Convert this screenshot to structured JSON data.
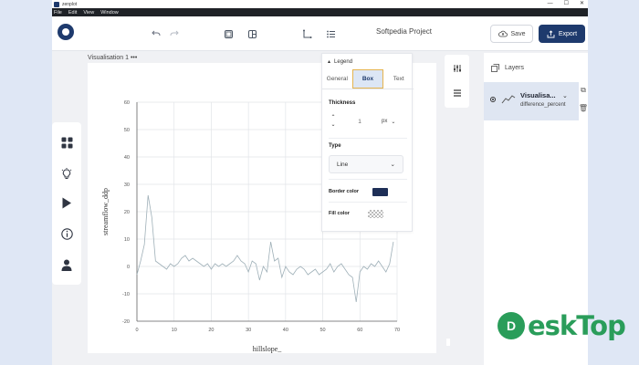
{
  "window": {
    "app_title": "zenplot",
    "controls": [
      "—",
      "☐",
      "✕"
    ]
  },
  "menu": [
    "File",
    "Edit",
    "View",
    "Window"
  ],
  "toolbar": {
    "project_title": "Softpedia Project",
    "save_label": "Save",
    "export_label": "Export"
  },
  "visualisation": {
    "title": "Visualisation 1"
  },
  "legend_panel": {
    "header": "Legend",
    "tabs": [
      "General",
      "Box",
      "Text"
    ],
    "active_tab": "Box",
    "thickness_label": "Thickness",
    "thickness_value": "1",
    "thickness_unit": "px",
    "type_label": "Type",
    "type_value": "Line",
    "border_color_label": "Border color",
    "border_color": "#1e2f57",
    "fill_color_label": "Fill color"
  },
  "layers_panel": {
    "title": "Layers",
    "items": [
      {
        "name": "Visualisa...",
        "subtitle": "difference_percent"
      }
    ]
  },
  "watermark": {
    "letter": "D",
    "text": "eskTop"
  },
  "colors": {
    "brand": "#1e3a6d",
    "series": "#9fb0b8",
    "watermark": "#2a9d5a"
  },
  "chart_data": {
    "type": "line",
    "xlabel": "hillslope_",
    "ylabel": "streamflow_ddp",
    "xlim": [
      0,
      70
    ],
    "ylim": [
      -20,
      60
    ],
    "xticks": [
      0,
      10,
      20,
      30,
      40,
      50,
      60,
      70
    ],
    "yticks": [
      -20,
      -10,
      0,
      10,
      20,
      30,
      40,
      50,
      60
    ],
    "grid": true,
    "series": [
      {
        "values": [
          [
            0,
            -3
          ],
          [
            1,
            2
          ],
          [
            2,
            8
          ],
          [
            3,
            26
          ],
          [
            4,
            18
          ],
          [
            5,
            2
          ],
          [
            6,
            1
          ],
          [
            7,
            0
          ],
          [
            8,
            -1
          ],
          [
            9,
            1
          ],
          [
            10,
            0
          ],
          [
            11,
            1
          ],
          [
            12,
            3
          ],
          [
            13,
            4
          ],
          [
            14,
            2
          ],
          [
            15,
            3
          ],
          [
            16,
            2
          ],
          [
            17,
            1
          ],
          [
            18,
            0
          ],
          [
            19,
            1
          ],
          [
            20,
            -1
          ],
          [
            21,
            1
          ],
          [
            22,
            0
          ],
          [
            23,
            1
          ],
          [
            24,
            0
          ],
          [
            25,
            1
          ],
          [
            26,
            2
          ],
          [
            27,
            4
          ],
          [
            28,
            2
          ],
          [
            29,
            1
          ],
          [
            30,
            -2
          ],
          [
            31,
            2
          ],
          [
            32,
            1
          ],
          [
            33,
            -5
          ],
          [
            34,
            0
          ],
          [
            35,
            -2
          ],
          [
            36,
            9
          ],
          [
            37,
            2
          ],
          [
            38,
            3
          ],
          [
            39,
            -4
          ],
          [
            40,
            0
          ],
          [
            41,
            -2
          ],
          [
            42,
            -3
          ],
          [
            43,
            -1
          ],
          [
            44,
            0
          ],
          [
            45,
            -1
          ],
          [
            46,
            -3
          ],
          [
            47,
            -2
          ],
          [
            48,
            -1
          ],
          [
            49,
            -3
          ],
          [
            50,
            -2
          ],
          [
            51,
            -1
          ],
          [
            52,
            1
          ],
          [
            53,
            -2
          ],
          [
            54,
            0
          ],
          [
            55,
            1
          ],
          [
            56,
            -1
          ],
          [
            57,
            -3
          ],
          [
            58,
            -4
          ],
          [
            59,
            -13
          ],
          [
            60,
            -2
          ],
          [
            61,
            0
          ],
          [
            62,
            -1
          ],
          [
            63,
            1
          ],
          [
            64,
            0
          ],
          [
            65,
            2
          ],
          [
            66,
            0
          ],
          [
            67,
            -2
          ],
          [
            68,
            1
          ],
          [
            69,
            9
          ]
        ]
      }
    ]
  }
}
